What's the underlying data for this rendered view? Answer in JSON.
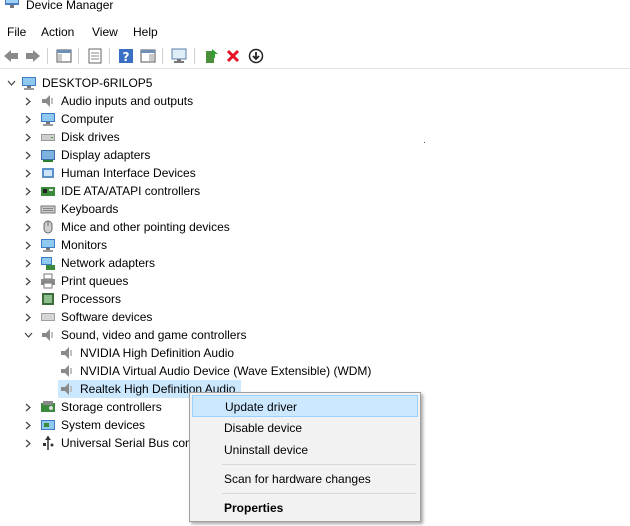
{
  "window": {
    "title": "Device Manager"
  },
  "menu": [
    "File",
    "Action",
    "View",
    "Help"
  ],
  "toolbar": {
    "buttons": [
      "back-arrow-icon",
      "forward-arrow-icon",
      "show-hide-console-tree-icon",
      "properties-icon",
      "help-icon",
      "action-pane-icon",
      "scan-hardware-icon",
      "update-driver-icon",
      "uninstall-icon",
      "disable-device-icon"
    ]
  },
  "tree": {
    "root": "DESKTOP-6RILOP5",
    "categories": [
      {
        "label": "Audio inputs and outputs",
        "icon": "speaker-icon"
      },
      {
        "label": "Computer",
        "icon": "monitor-icon"
      },
      {
        "label": "Disk drives",
        "icon": "disk-drive-icon"
      },
      {
        "label": "Display adapters",
        "icon": "display-adapter-icon"
      },
      {
        "label": "Human Interface Devices",
        "icon": "hid-icon"
      },
      {
        "label": "IDE ATA/ATAPI controllers",
        "icon": "ide-controller-icon"
      },
      {
        "label": "Keyboards",
        "icon": "keyboard-icon"
      },
      {
        "label": "Mice and other pointing devices",
        "icon": "mouse-icon"
      },
      {
        "label": "Monitors",
        "icon": "monitor-icon"
      },
      {
        "label": "Network adapters",
        "icon": "network-adapter-icon"
      },
      {
        "label": "Print queues",
        "icon": "printer-icon"
      },
      {
        "label": "Processors",
        "icon": "processor-icon"
      },
      {
        "label": "Software devices",
        "icon": "software-device-icon"
      },
      {
        "label": "Sound, video and game controllers",
        "icon": "speaker-icon"
      }
    ],
    "sound_children": [
      {
        "label": "NVIDIA High Definition Audio"
      },
      {
        "label": "NVIDIA Virtual Audio Device (Wave Extensible) (WDM)"
      },
      {
        "label": "Realtek High Definition Audio"
      }
    ],
    "after": [
      {
        "label": "Storage controllers",
        "icon": "storage-controller-icon"
      },
      {
        "label": "System devices",
        "icon": "system-devices-icon"
      },
      {
        "label": "Universal Serial Bus cont",
        "icon": "usb-icon"
      }
    ]
  },
  "context_menu": {
    "update": "Update driver",
    "disable": "Disable device",
    "uninstall": "Uninstall device",
    "scan": "Scan for hardware changes",
    "properties": "Properties"
  },
  "colors": {
    "selection": "#cce8ff",
    "menu_bg": "#f2f2f2",
    "highlight": "#cce8ff",
    "uninstall_x": "#e81123"
  }
}
